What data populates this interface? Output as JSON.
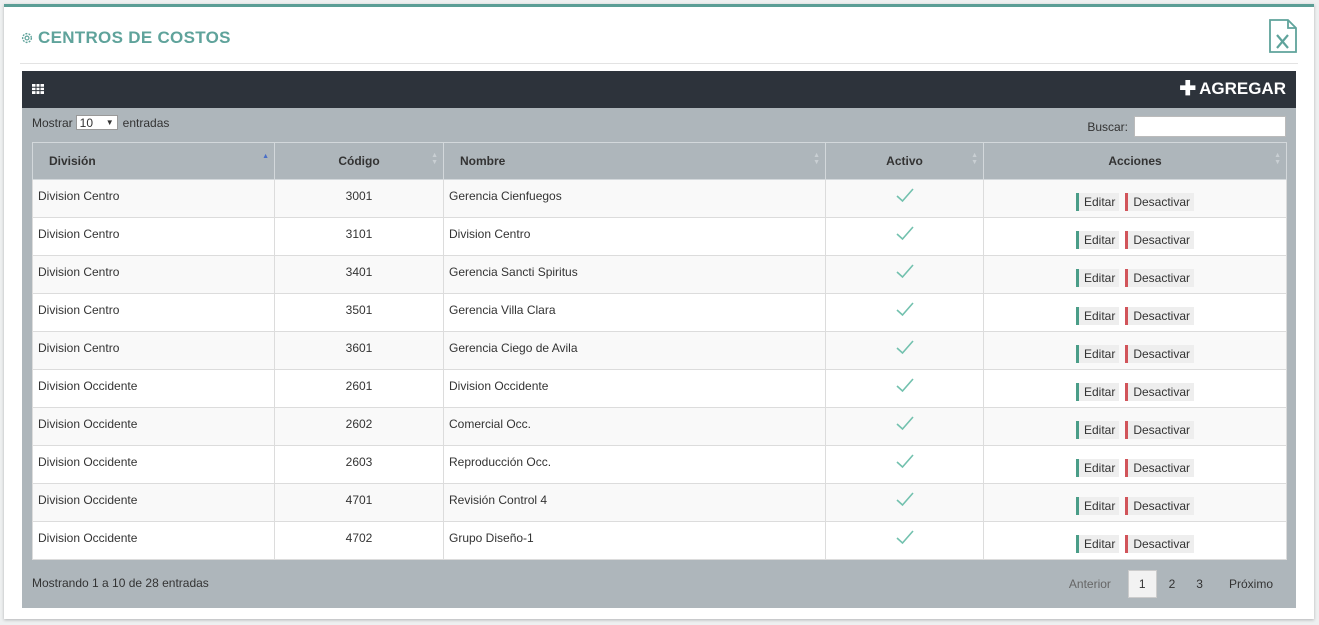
{
  "header": {
    "title": "CENTROS DE COSTOS",
    "excel_icon": "excel-export-icon"
  },
  "toolbar": {
    "grid_icon": "table-icon",
    "add_label": "AGREGAR"
  },
  "controls": {
    "show_label": "Mostrar",
    "page_size": "10",
    "entries_label": "entradas",
    "search_label": "Buscar:",
    "search_value": ""
  },
  "table": {
    "columns": [
      "División",
      "Código",
      "Nombre",
      "Activo",
      "Acciones"
    ],
    "rows": [
      {
        "division": "Division Centro",
        "code": "3001",
        "name": "Gerencia Cienfuegos",
        "active": true,
        "edit": "Editar",
        "deactivate": "Desactivar"
      },
      {
        "division": "Division Centro",
        "code": "3101",
        "name": "Division Centro",
        "active": true,
        "edit": "Editar",
        "deactivate": "Desactivar"
      },
      {
        "division": "Division Centro",
        "code": "3401",
        "name": "Gerencia Sancti Spiritus",
        "active": true,
        "edit": "Editar",
        "deactivate": "Desactivar"
      },
      {
        "division": "Division Centro",
        "code": "3501",
        "name": "Gerencia Villa Clara",
        "active": true,
        "edit": "Editar",
        "deactivate": "Desactivar"
      },
      {
        "division": "Division Centro",
        "code": "3601",
        "name": "Gerencia Ciego de Avila",
        "active": true,
        "edit": "Editar",
        "deactivate": "Desactivar"
      },
      {
        "division": "Division Occidente",
        "code": "2601",
        "name": "Division Occidente",
        "active": true,
        "edit": "Editar",
        "deactivate": "Desactivar"
      },
      {
        "division": "Division Occidente",
        "code": "2602",
        "name": "Comercial Occ.",
        "active": true,
        "edit": "Editar",
        "deactivate": "Desactivar"
      },
      {
        "division": "Division Occidente",
        "code": "2603",
        "name": "Reproducción Occ.",
        "active": true,
        "edit": "Editar",
        "deactivate": "Desactivar"
      },
      {
        "division": "Division Occidente",
        "code": "4701",
        "name": "Revisión Control 4",
        "active": true,
        "edit": "Editar",
        "deactivate": "Desactivar"
      },
      {
        "division": "Division Occidente",
        "code": "4702",
        "name": "Grupo Diseño-1",
        "active": true,
        "edit": "Editar",
        "deactivate": "Desactivar"
      }
    ]
  },
  "footer": {
    "info": "Mostrando 1 a 10 de 28 entradas",
    "prev_label": "Anterior",
    "pages": [
      "1",
      "2",
      "3"
    ],
    "current_page": "1",
    "next_label": "Próximo"
  },
  "colors": {
    "accent": "#5fa39b",
    "bar": "#2d333b",
    "panel": "#aeb6bb",
    "check": "#72c1ae",
    "edit": "#4a9d88",
    "deactivate": "#d1545a"
  }
}
